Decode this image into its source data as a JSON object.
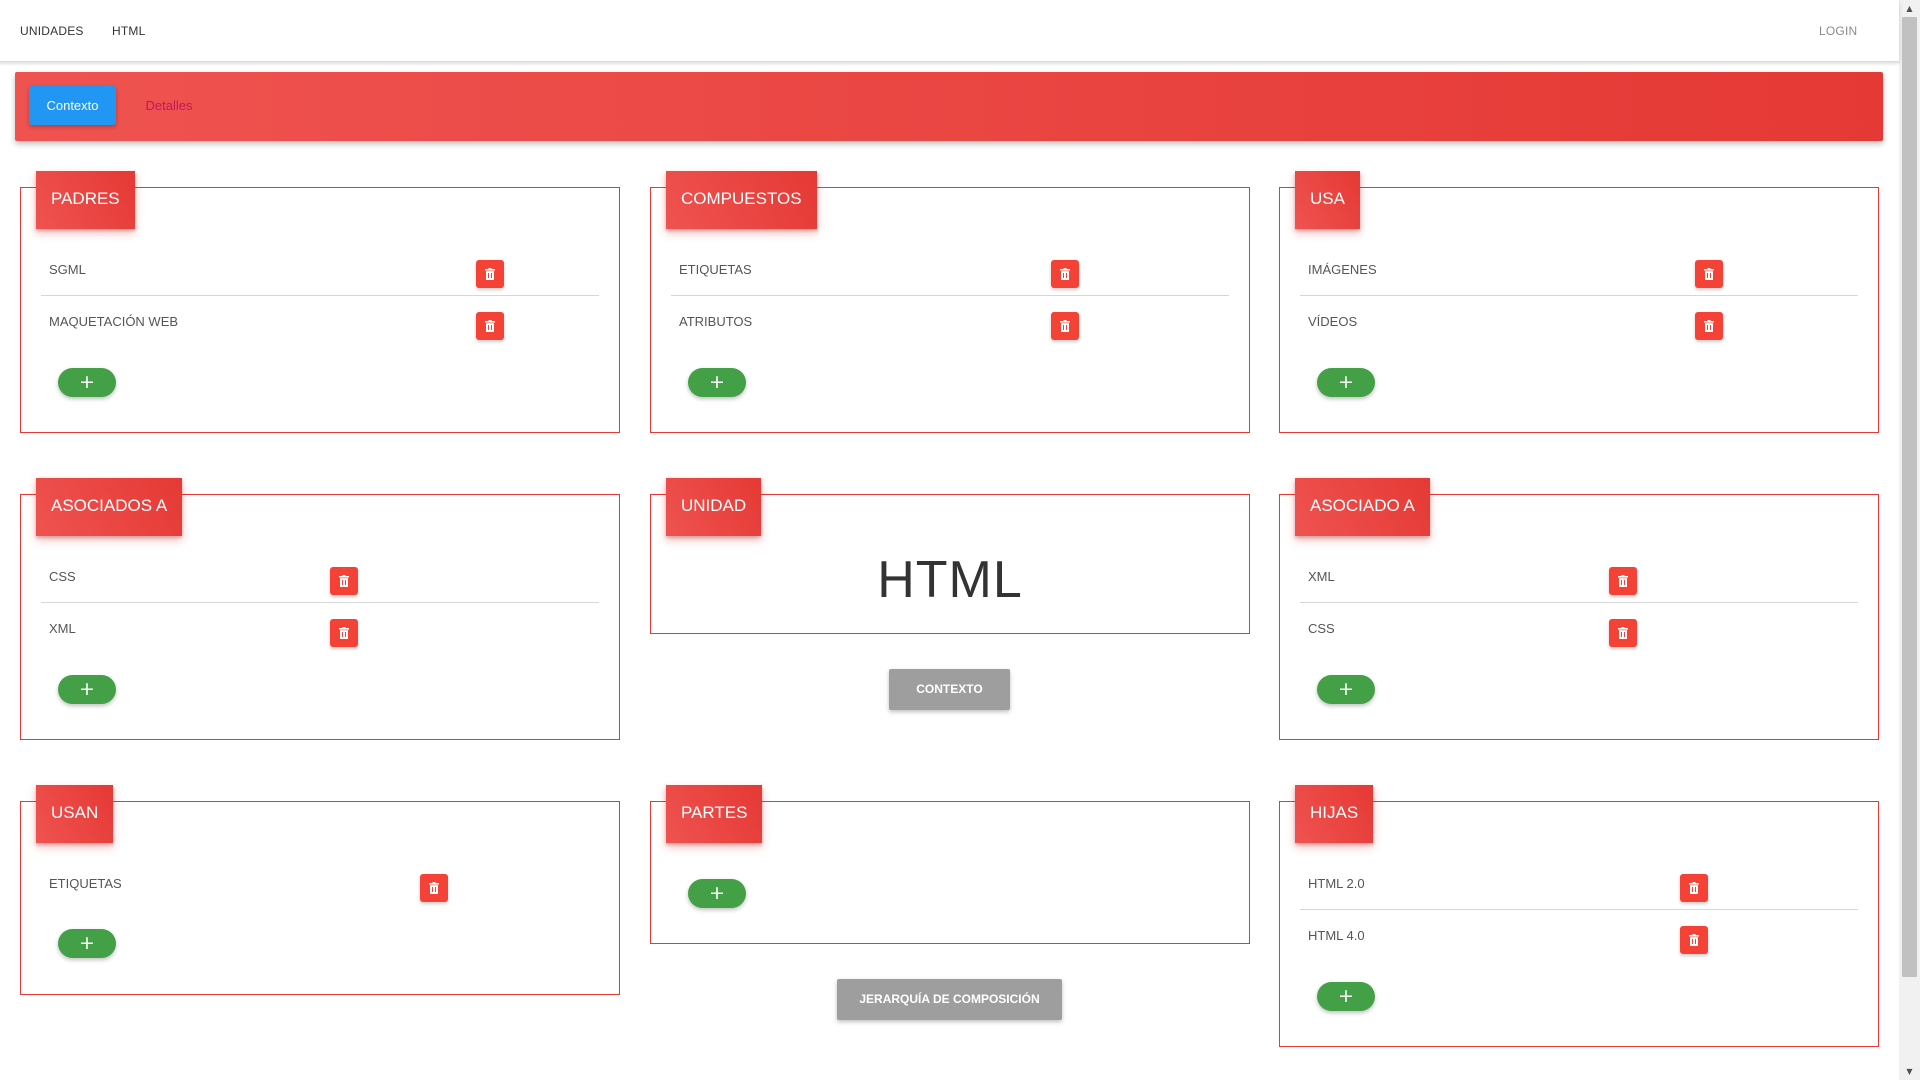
{
  "nav": {
    "units_label": "UNIDADES",
    "html_label": "HTML",
    "login_label": "LOGIN"
  },
  "tabs": {
    "context_label": "Contexto",
    "details_label": "Detalles"
  },
  "cards": {
    "padres": {
      "title": "PADRES",
      "items": [
        "SGML",
        "MAQUETACIÓN WEB"
      ],
      "add_label": "+"
    },
    "compuestos": {
      "title": "COMPUESTOS",
      "items": [
        "ETIQUETAS",
        "ATRIBUTOS"
      ],
      "add_label": "+"
    },
    "usa": {
      "title": "USA",
      "items": [
        "IMÁGENES",
        "VÍDEOS"
      ],
      "add_label": "+"
    },
    "asociados_a": {
      "title": "ASOCIADOS A",
      "items": [
        "CSS",
        "XML"
      ],
      "add_label": "+"
    },
    "unidad": {
      "title": "UNIDAD",
      "name": "HTML"
    },
    "asociado_a": {
      "title": "ASOCIADO A",
      "items": [
        "XML",
        "CSS"
      ],
      "add_label": "+"
    },
    "usan": {
      "title": "USAN",
      "items": [
        "ETIQUETAS"
      ],
      "add_label": "+"
    },
    "partes": {
      "title": "PARTES",
      "items": [],
      "add_label": "+"
    },
    "hijas": {
      "title": "HIJAS",
      "items": [
        "HTML 2.0",
        "HTML 4.0"
      ],
      "add_label": "+"
    }
  },
  "buttons": {
    "context_label": "CONTEXTO",
    "hierarchy_label": "JERARQUÍA DE COMPOSICIÓN"
  },
  "colors": {
    "accent_red": "#e53935",
    "tab_blue": "#2196f3",
    "add_green": "#43a047",
    "delete_red": "#f44336",
    "neutral_gray": "#9e9e9e"
  },
  "icons": {
    "delete": "trash-icon",
    "add": "plus-icon"
  }
}
